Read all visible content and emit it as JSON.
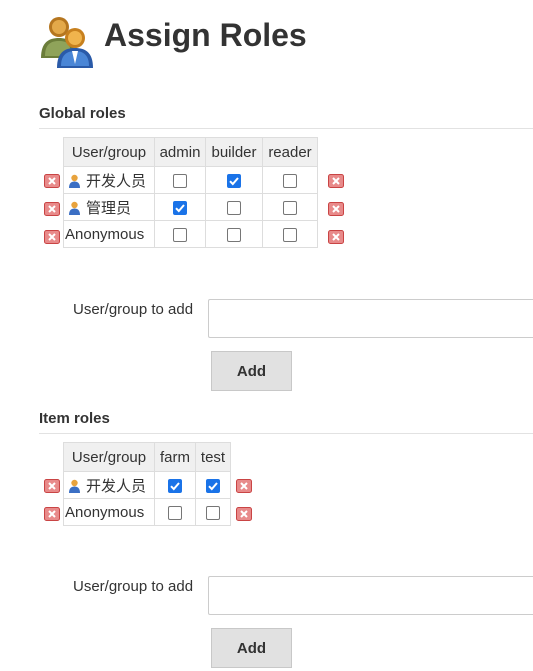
{
  "header": {
    "title": "Assign Roles",
    "icon": "assign-roles-icon"
  },
  "global_roles": {
    "title": "Global roles",
    "columns": [
      "User/group",
      "admin",
      "builder",
      "reader"
    ],
    "rows": [
      {
        "name": "开发人员",
        "user_icon": true,
        "checks": [
          false,
          true,
          false
        ]
      },
      {
        "name": "管理员",
        "user_icon": true,
        "checks": [
          true,
          false,
          false
        ]
      },
      {
        "name": "Anonymous",
        "user_icon": false,
        "checks": [
          false,
          false,
          false
        ]
      }
    ],
    "add_label": "User/group to add",
    "add_value": "",
    "add_button": "Add"
  },
  "item_roles": {
    "title": "Item roles",
    "columns": [
      "User/group",
      "farm",
      "test"
    ],
    "rows": [
      {
        "name": "开发人员",
        "user_icon": true,
        "checks": [
          true,
          true
        ]
      },
      {
        "name": "Anonymous",
        "user_icon": false,
        "checks": [
          false,
          false
        ]
      }
    ],
    "add_label": "User/group to add",
    "add_value": "",
    "add_button": "Add"
  },
  "colors": {
    "checkbox_checked": "#1a73e8",
    "table_header_bg": "#f0f0f0",
    "delete_icon": "#d9534f",
    "button_bg": "#e1e1e1"
  }
}
